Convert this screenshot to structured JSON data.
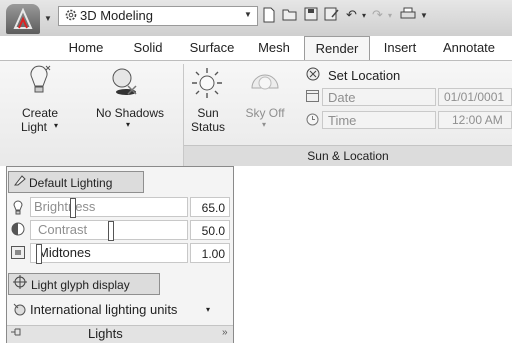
{
  "titlebar": {
    "workspace": "3D Modeling"
  },
  "tabs": [
    {
      "label": "Home"
    },
    {
      "label": "Solid"
    },
    {
      "label": "Surface"
    },
    {
      "label": "Mesh"
    },
    {
      "label": "Render",
      "active": true
    },
    {
      "label": "Insert"
    },
    {
      "label": "Annotate"
    }
  ],
  "ribbon": {
    "create_light": {
      "line1": "Create",
      "line2": "Light"
    },
    "no_shadows": "No Shadows",
    "sun_status": {
      "line1": "Sun",
      "line2": "Status"
    },
    "sky_off": "Sky Off",
    "set_location": "Set Location",
    "date_label": "Date",
    "date_value": "01/01/0001",
    "time_label": "Time",
    "time_value": "12:00 AM",
    "panel_title": "Sun & Location"
  },
  "lights_panel": {
    "default_lighting": "Default Lighting",
    "brightness": {
      "label": "Brightness",
      "value": "65.0"
    },
    "contrast": {
      "label": "Contrast",
      "value": "50.0"
    },
    "midtones": {
      "label": "Midtones",
      "value": "1.00"
    },
    "glyph_display": "Light glyph display",
    "units": "International lighting units",
    "title": "Lights"
  }
}
